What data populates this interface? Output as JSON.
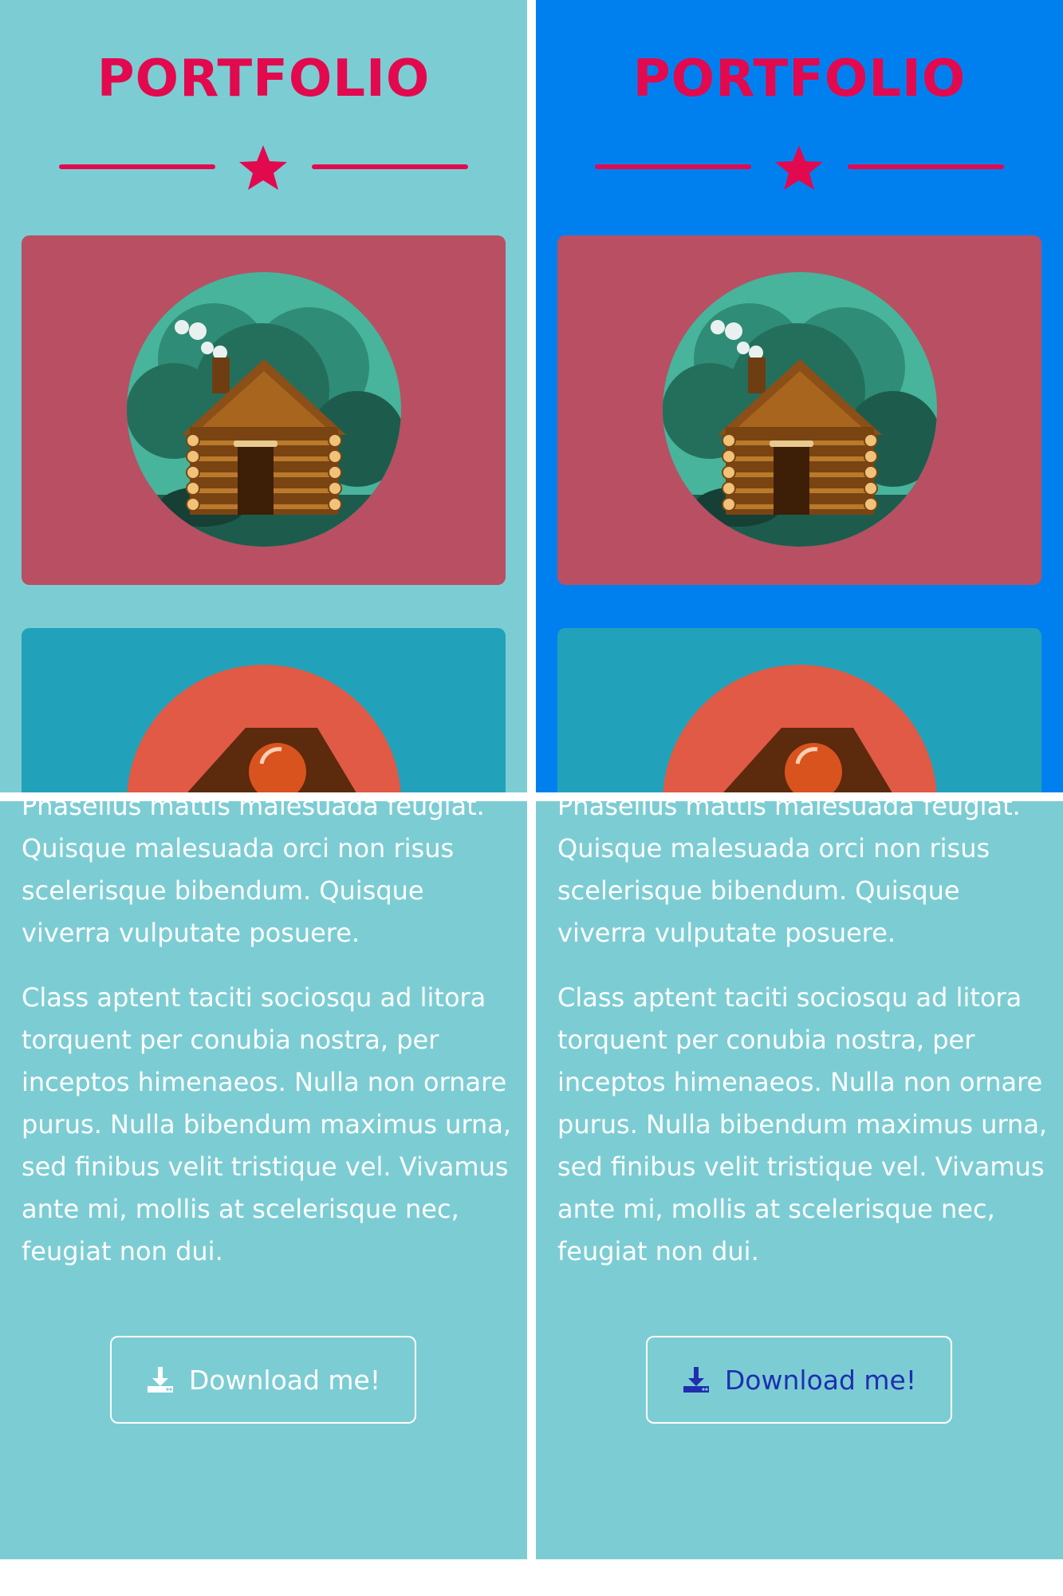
{
  "panels": [
    {
      "id": "left",
      "top_background": "#7ccdd3",
      "title": "PORTFOLIO",
      "paragraph_1": "Phasellus mattis malesuada feugiat. Quisque malesuada orci non risus scelerisque bibendum. Quisque viverra vulputate posuere.",
      "paragraph_2": "Class aptent taciti sociosqu ad litora torquent per conubia nostra, per inceptos himenaeos. Nulla non ornare purus. Nulla bibendum maximus urna, sed finibus velit tristique vel. Vivamus ante mi, mollis at scelerisque nec, feugiat non dui.",
      "button_label": "Download me!",
      "button_text_color": "#ffffff",
      "button_icon": "download-icon"
    },
    {
      "id": "right",
      "top_background": "#0080ef",
      "title": "PORTFOLIO",
      "paragraph_1": "Phasellus mattis malesuada feugiat. Quisque malesuada orci non risus scelerisque bibendum. Quisque viverra vulputate posuere.",
      "paragraph_2": "Class aptent taciti sociosqu ad litora torquent per conubia nostra, per inceptos himenaeos. Nulla non ornare purus. Nulla bibendum maximus urna, sed finibus velit tristique vel. Vivamus ante mi, mollis at scelerisque nec, feugiat non dui.",
      "button_label": "Download me!",
      "button_text_color": "#1f2fb0",
      "button_icon": "download-icon"
    }
  ],
  "colors": {
    "accent": "#e2094f",
    "bottom_background": "#7ccdd3",
    "cabin_card": "#b94f63",
    "second_card": "#21a2ba"
  }
}
